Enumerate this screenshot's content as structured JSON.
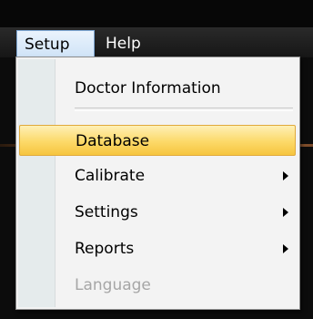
{
  "menubar": {
    "items": [
      {
        "label": "Setup",
        "active": true
      },
      {
        "label": "Help",
        "active": false
      }
    ]
  },
  "setup_menu": {
    "items": [
      {
        "label": "Doctor Information",
        "submenu": false,
        "enabled": true,
        "highlighted": false
      },
      {
        "label": "Database",
        "submenu": false,
        "enabled": true,
        "highlighted": true
      },
      {
        "label": "Calibrate",
        "submenu": true,
        "enabled": true,
        "highlighted": false
      },
      {
        "label": "Settings",
        "submenu": true,
        "enabled": true,
        "highlighted": false
      },
      {
        "label": "Reports",
        "submenu": true,
        "enabled": true,
        "highlighted": false
      },
      {
        "label": "Language",
        "submenu": false,
        "enabled": false,
        "highlighted": false
      }
    ]
  },
  "colors": {
    "highlight": "#fcd968",
    "menubar_bg": "#1e1e1e",
    "disabled_text": "#a6a6a6"
  }
}
